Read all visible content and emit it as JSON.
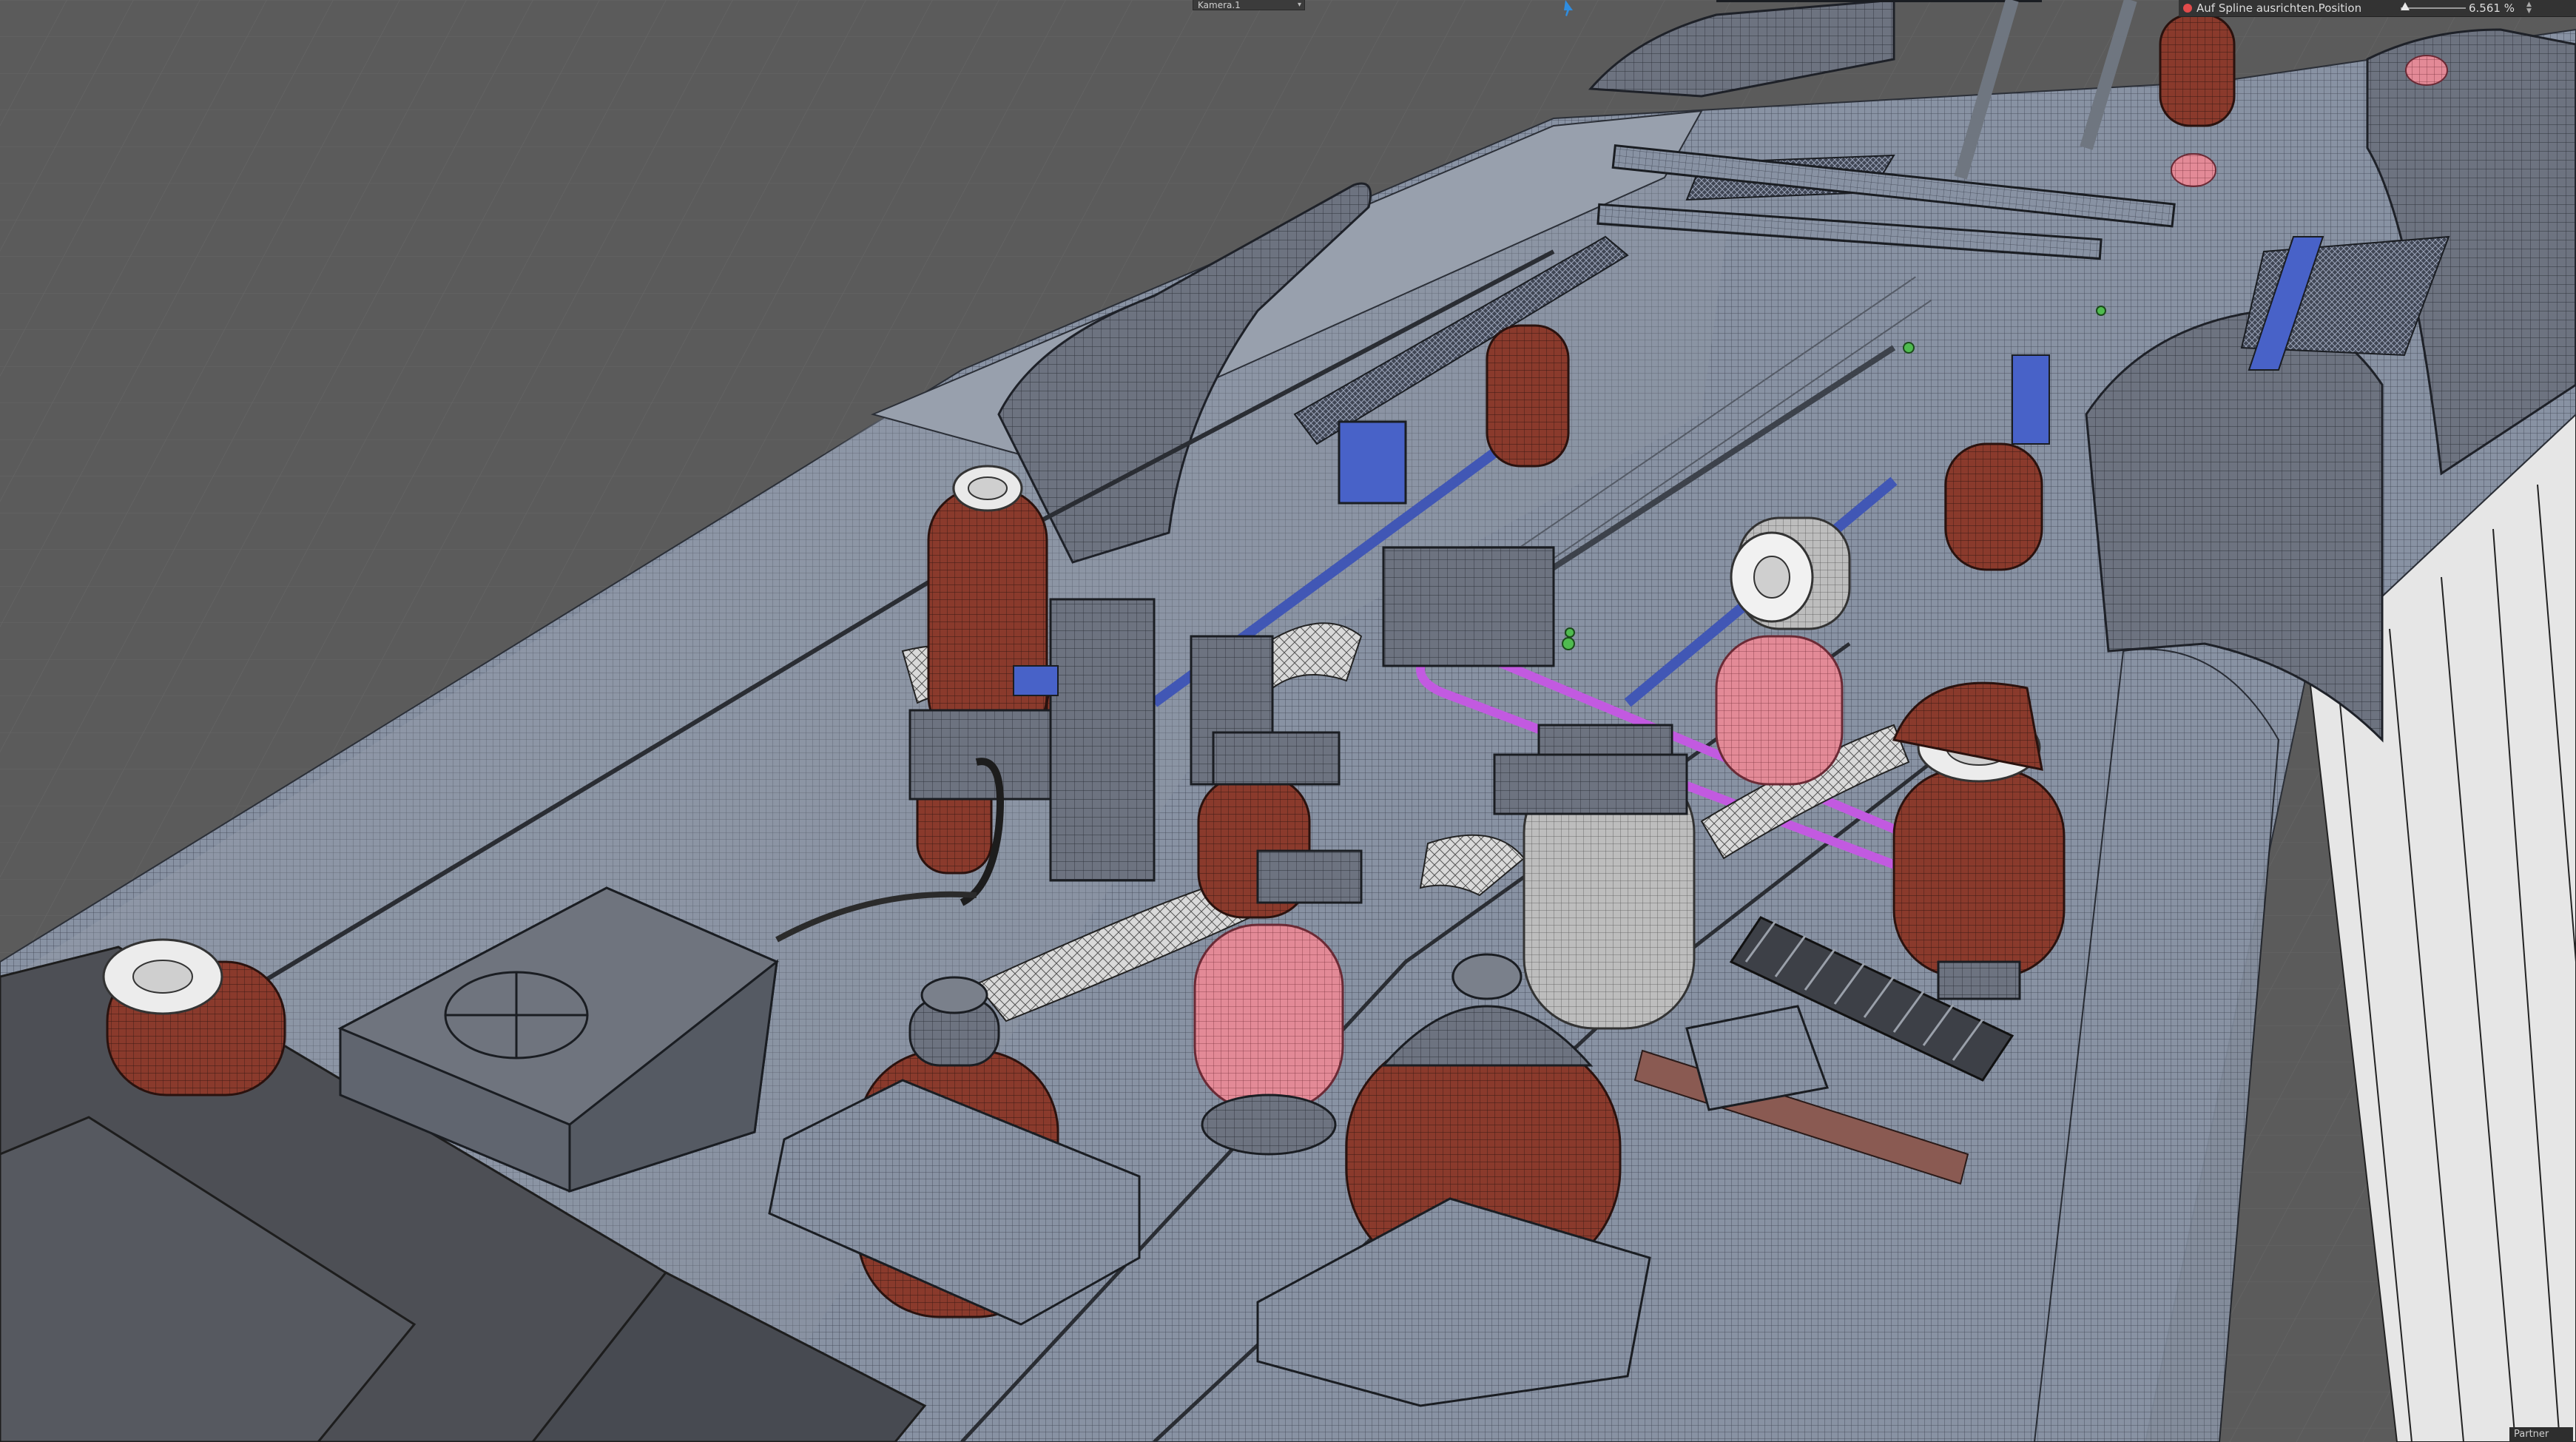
{
  "viewport": {
    "camera_name": "Kamera.1",
    "spline_param_label": "Auf Spline ausrichten.Position",
    "spline_param_value": "6.561 %",
    "spline_param_fraction": 0.06561,
    "bottom_label": "Partner"
  },
  "colors": {
    "background": "#5a5a5a",
    "insulator_brown": "#8a3a2c",
    "insulator_pink": "#e38a97",
    "insulator_grey": "#b8b8b8",
    "hull": "#8b93a1",
    "accent_blue": "#3f5bbd",
    "accent_magenta": "#c25ae0",
    "status_red": "#e24b4b"
  }
}
